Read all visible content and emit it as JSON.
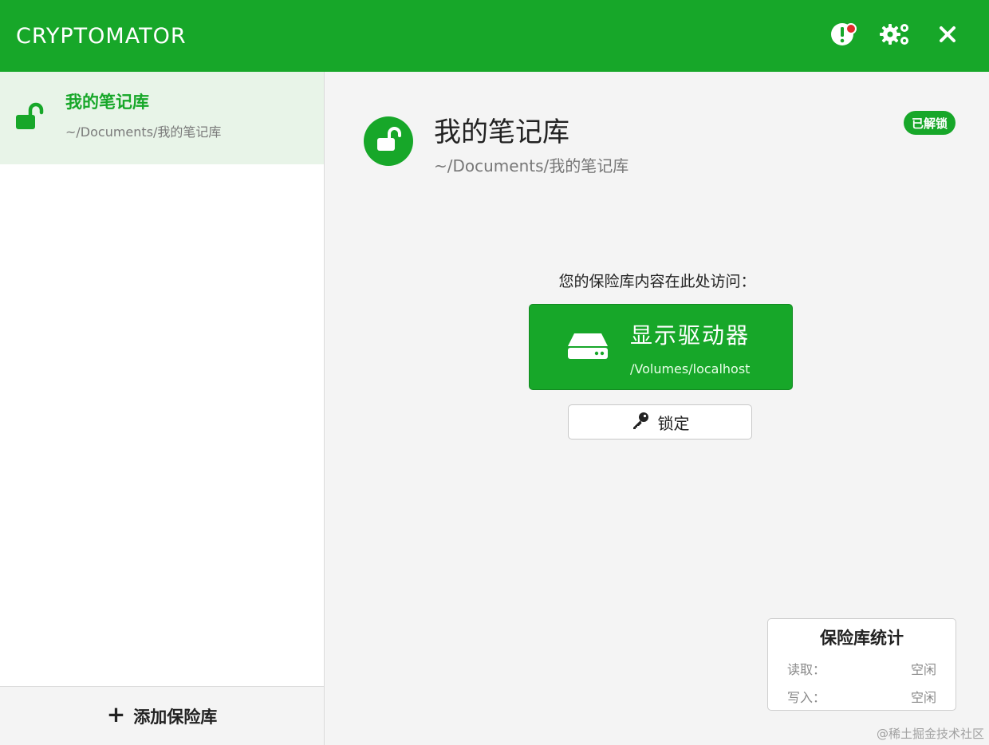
{
  "app": {
    "title": "CRYPTOMATOR",
    "accent_color": "#17a729",
    "notification_color": "#e12b2b"
  },
  "titlebar": {
    "icons": [
      "alert-icon",
      "settings-icon",
      "close-icon"
    ]
  },
  "sidebar": {
    "vaults": [
      {
        "name": "我的笔记库",
        "path": "~/Documents/我的笔记库",
        "icon": "unlocked-padlock-icon",
        "selected": true
      }
    ],
    "add_vault_label": "添加保险库",
    "add_vault_icon": "plus-icon"
  },
  "main": {
    "vault_name": "我的笔记库",
    "vault_path": "~/Documents/我的笔记库",
    "status_badge": "已解锁",
    "access_label": "您的保险库内容在此处访问：",
    "reveal_button": {
      "title": "显示驱动器",
      "subtitle": "/Volumes/localhost",
      "icon": "drive-icon"
    },
    "lock_button": {
      "label": "锁定",
      "icon": "key-icon"
    },
    "stats": {
      "title": "保险库统计",
      "read_label": "读取：",
      "read_value": "空闲",
      "write_label": "写入：",
      "write_value": "空闲"
    }
  },
  "watermark": "@稀土掘金技术社区"
}
